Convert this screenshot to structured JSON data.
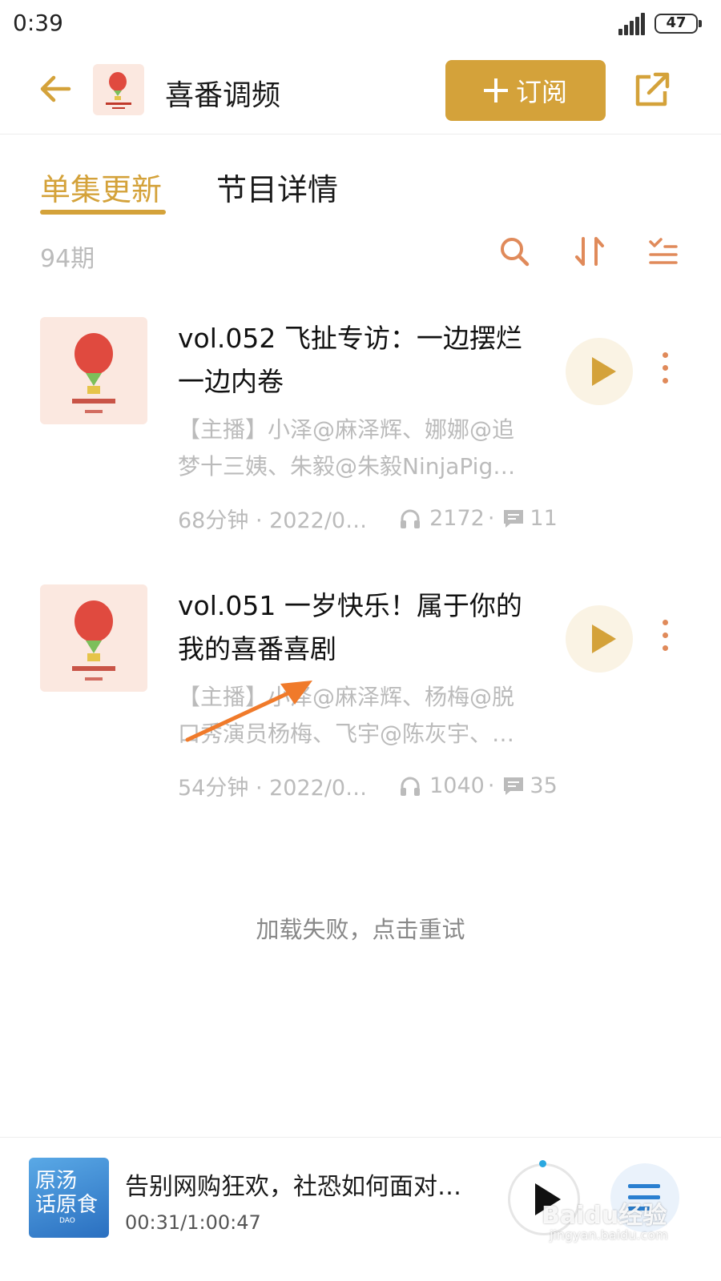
{
  "status_bar": {
    "time": "0:39",
    "battery": "47"
  },
  "header": {
    "title": "喜番调频",
    "subscribe_label": "订阅"
  },
  "tabs": [
    {
      "label": "单集更新",
      "active": true
    },
    {
      "label": "节目详情",
      "active": false
    }
  ],
  "episode_count": "94期",
  "episodes": [
    {
      "title": "vol.052 飞扯专访：一边摆烂一边内卷",
      "hosts_line1": "【主播】小泽@麻泽辉、娜娜@追",
      "hosts_line2": "梦十三姨、朱毅@朱毅NinjaPig…",
      "duration_date": "68分钟 · 2022/0…",
      "plays": "2172",
      "comments": "11"
    },
    {
      "title": "vol.051 一岁快乐！属于你的我的喜番喜剧",
      "hosts_line1": "【主播】小泽@麻泽辉、杨梅@脱",
      "hosts_line2": "口秀演员杨梅、飞宇@陈灰宇、…",
      "duration_date": "54分钟 · 2022/0…",
      "plays": "1040",
      "comments": "35"
    }
  ],
  "load_failed_text": "加载失败，点击重试",
  "mini_player": {
    "cover_text_line1": "原汤",
    "cover_text_line2": "话原食",
    "cover_mark": "DAO",
    "title": "告别网购狂欢，社恐如何面对…",
    "time": "00:31/1:00:47"
  },
  "watermark": {
    "text": "Baidu经验",
    "sub": "jingyan.baidu.com"
  },
  "colors": {
    "accent": "#d4a23a",
    "icon_orange": "#e08a5a",
    "muted": "#bbbbbb"
  }
}
